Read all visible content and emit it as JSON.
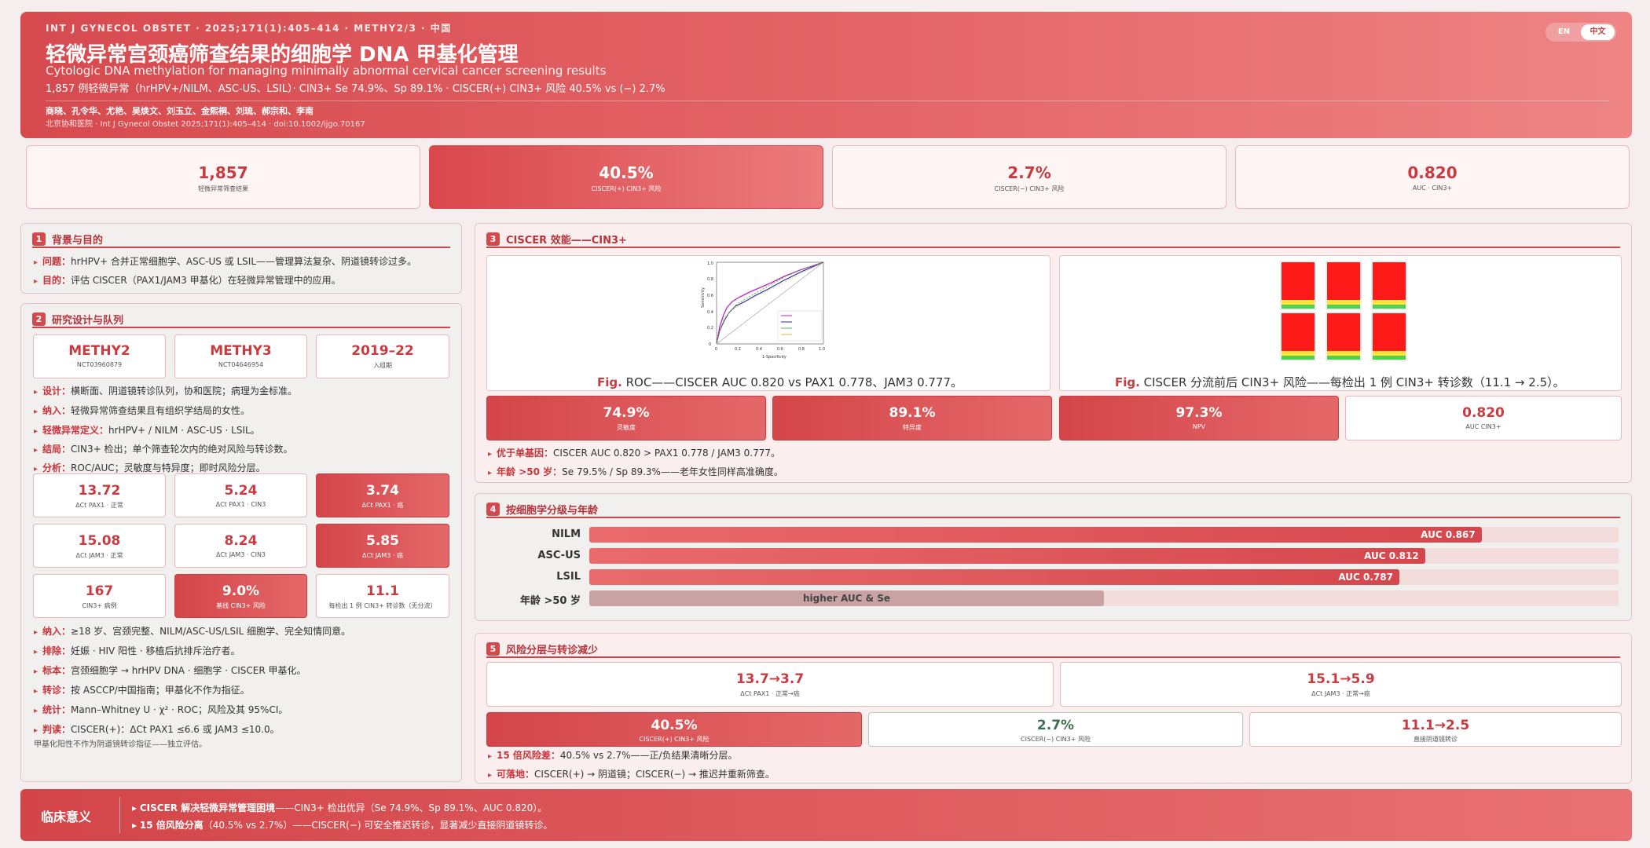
{
  "header": {
    "journal": "INT J GYNECOL OBSTET · 2025;171(1):405–414 · METHY2/3 · 中国",
    "title": "轻微异常宫颈癌筛查结果的细胞学 DNA 甲基化管理",
    "subtitle": "Cytologic DNA methylation for managing minimally abnormal cervical cancer screening results",
    "stats": "1,857 例轻微异常（hrHPV+/NILM、ASC-US、LSIL）· CIN3+ Se 74.9%、Sp 89.1% · CISCER(+) CIN3+ 风险 40.5% vs (−) 2.7%",
    "authors": "商晓、孔令华、尤艳、吴焕文、刘玉立、金熙桐、刘琉、郝宗和、李南",
    "affiliation": "北京协和医院 · Int J Gynecol Obstet 2025;171(1):405–414 · doi:10.1002/ijgo.70167",
    "lang_en": "EN",
    "lang_zh": "中文"
  },
  "kpis": [
    {
      "value": "1,857",
      "label": "轻微异常筛查结果"
    },
    {
      "value": "40.5%",
      "label": "CISCER(+) CIN3+ 风险"
    },
    {
      "value": "2.7%",
      "label": "CISCER(−) CIN3+ 风险"
    },
    {
      "value": "0.820",
      "label": "AUC · CIN3+"
    }
  ],
  "s1": {
    "num": "1",
    "title": "背景与目的",
    "b1k": "问题：",
    "b1": "hrHPV+ 合并正常细胞学、ASC-US 或 LSIL——管理算法复杂、阴道镜转诊过多。",
    "b2k": "目的：",
    "b2": "评估 CISCER（PAX1/JAM3 甲基化）在轻微异常管理中的应用。"
  },
  "s2": {
    "num": "2",
    "title": "研究设计与队列",
    "trial1": {
      "value": "METHY2",
      "label": "NCT03960879"
    },
    "trial2": {
      "value": "METHY3",
      "label": "NCT04646954"
    },
    "trial3": {
      "value": "2019–22",
      "label": "入组期"
    },
    "d1k": "设计：",
    "d1": "横断面、阴道镜转诊队列，协和医院；病理为金标准。",
    "d2k": "纳入：",
    "d2": "轻微异常筛查结果且有组织学结局的女性。",
    "d3k": "轻微异常定义：",
    "d3": "hrHPV+ / NILM · ASC-US · LSIL。",
    "d4k": "结局：",
    "d4": "CIN3+ 检出；单个筛查轮次内的绝对风险与转诊数。",
    "d5k": "分析：",
    "d5": "ROC/AUC；灵敏度与特异度；即时风险分层。",
    "grid": [
      {
        "value": "13.72",
        "label": "ΔCt PAX1 · 正常"
      },
      {
        "value": "5.24",
        "label": "ΔCt PAX1 · CIN3"
      },
      {
        "value": "3.74",
        "label": "ΔCt PAX1 · 癌"
      },
      {
        "value": "15.08",
        "label": "ΔCt JAM3 · 正常"
      },
      {
        "value": "8.24",
        "label": "ΔCt JAM3 · CIN3"
      },
      {
        "value": "5.85",
        "label": "ΔCt JAM3 · 癌"
      },
      {
        "value": "167",
        "label": "CIN3+ 病例"
      },
      {
        "value": "9.0%",
        "label": "基线 CIN3+ 风险"
      },
      {
        "value": "11.1",
        "label": "每检出 1 例 CIN3+ 转诊数（无分流）"
      }
    ],
    "e1k": "纳入：",
    "e1": "≥18 岁、宫颈完整、NILM/ASC-US/LSIL 细胞学、完全知情同意。",
    "e2k": "排除：",
    "e2": "妊娠 · HIV 阳性 · 移植后抗排斥治疗者。",
    "e3k": "标本：",
    "e3": "宫颈细胞学 → hrHPV DNA · 细胞学 · CISCER 甲基化。",
    "e4k": "转诊：",
    "e4": "按 ASCCP/中国指南；甲基化不作为指征。",
    "e5k": "统计：",
    "e5": "Mann–Whitney U · χ² · ROC；风险及其 95%CI。",
    "e6k": "判读：",
    "e6": "CISCER(+)：ΔCt PAX1 ≤6.6 或 JAM3 ≤10.0。",
    "note": "甲基化阳性不作为阴道镜转诊指征——独立评估。"
  },
  "s3": {
    "num": "3",
    "title": "CISCER 效能——CIN3+",
    "roc": {
      "ylabel": "Sensitivity",
      "xlabel": "1-Specificity",
      "ticks": [
        "0",
        "0.2",
        "0.4",
        "0.6",
        "0.8",
        "1.0"
      ]
    },
    "cap1_fig": "Fig.",
    "cap1": " ROC——CISCER AUC 0.820 vs PAX1 0.778、JAM3 0.777。",
    "cap2_fig": "Fig.",
    "cap2": " CISCER 分流前后 CIN3+ 风险——每检出 1 例 CIN3+ 转诊数（11.1 → 2.5）。",
    "metrics": [
      {
        "value": "74.9%",
        "label": "灵敏度"
      },
      {
        "value": "89.1%",
        "label": "特异度"
      },
      {
        "value": "97.3%",
        "label": "NPV"
      },
      {
        "value": "0.820",
        "label": "AUC CIN3+"
      }
    ],
    "b1k": "优于单基因：",
    "b1": "CISCER AUC 0.820 > PAX1 0.778 / JAM3 0.777。",
    "b2k": "年龄 >50 岁：",
    "b2": "Se 79.5% / Sp 89.3%——老年女性同样高准确度。",
    "colors": {
      "heat_red": "#ff1a1a",
      "heat_yellow": "#ffe23c",
      "heat_green": "#4fd14f"
    }
  },
  "s4": {
    "num": "4",
    "title": "按细胞学分级与年龄",
    "chart_data": {
      "type": "bar",
      "categories": [
        "NILM",
        "ASC-US",
        "LSIL",
        "年龄 >50 岁"
      ],
      "values": [
        0.867,
        0.812,
        0.787,
        null
      ],
      "labels": [
        "AUC 0.867",
        "AUC 0.812",
        "AUC 0.787",
        "higher AUC & Se"
      ]
    }
  },
  "s5": {
    "num": "5",
    "title": "风险分层与转诊减少",
    "top": [
      {
        "value": "13.7→3.7",
        "label": "ΔCt PAX1 · 正常→癌"
      },
      {
        "value": "15.1→5.9",
        "label": "ΔCt JAM3 · 正常→癌"
      }
    ],
    "mid": [
      {
        "value": "40.5%",
        "label": "CISCER(+) CIN3+ 风险"
      },
      {
        "value": "2.7%",
        "label": "CISCER(−) CIN3+ 风险"
      },
      {
        "value": "11.1→2.5",
        "label": "直接阴道镜转诊"
      }
    ],
    "b1k": "15 倍风险差：",
    "b1": "40.5% vs 2.7%——正/负结果清晰分层。",
    "b2k": "可落地：",
    "b2": "CISCER(+) → 阴道镜；CISCER(−) → 推迟并重新筛查。"
  },
  "footer": {
    "title": "临床意义",
    "l1b": "CISCER 解决轻微异常管理困境",
    "l1": "——CIN3+ 检出优异（Se 74.9%、Sp 89.1%、AUC 0.820）。",
    "l2b": "15 倍风险分离",
    "l2": "（40.5% vs 2.7%）——CISCER(−) 可安全推迟转诊，显著减少直接阴道镜转诊。"
  }
}
